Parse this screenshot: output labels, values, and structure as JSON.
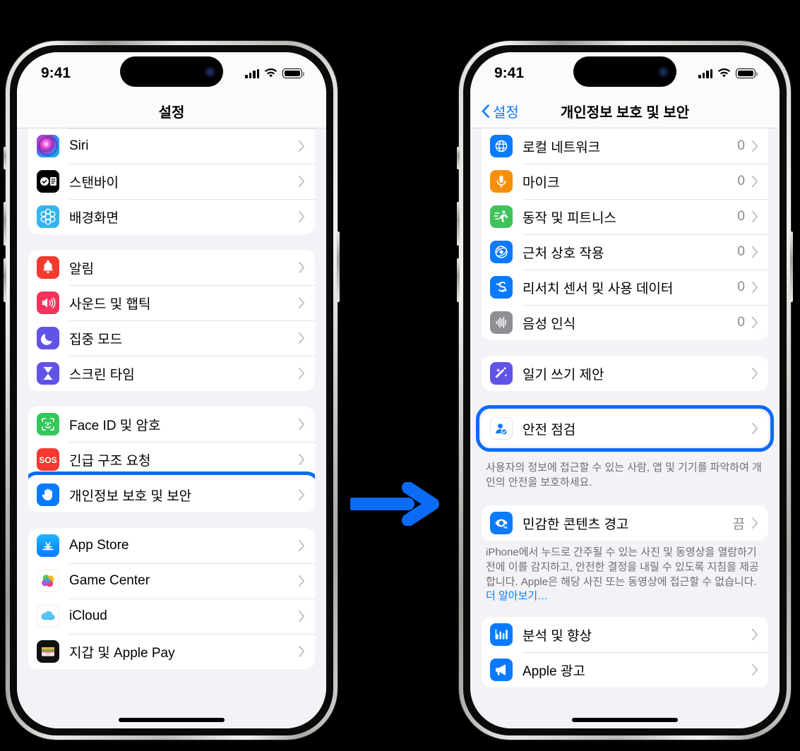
{
  "meta": {
    "background_color": "#000000",
    "accent_color": "#0a6cf5",
    "ios_blue": "#0a7aff"
  },
  "arrow": {
    "name": "right-arrow",
    "color": "#0a6cf5"
  },
  "phones": [
    {
      "id": "settings-phone",
      "status_bar": {
        "time": "9:41",
        "signal": "cellular-bars-icon",
        "wifi": "wifi-icon",
        "battery": "battery-full-icon"
      },
      "nav": {
        "title": "설정",
        "back_label": null
      },
      "groups": [
        {
          "flush_top": true,
          "rows": [
            {
              "label": "Siri",
              "icon": "siri-icon",
              "value": "",
              "highlighted": false
            },
            {
              "label": "스탠바이",
              "icon": "standby-icon",
              "value": "",
              "highlighted": false
            },
            {
              "label": "배경화면",
              "icon": "wallpaper-icon",
              "value": "",
              "highlighted": false
            }
          ]
        },
        {
          "rows": [
            {
              "label": "알림",
              "icon": "notifications-icon",
              "value": "",
              "highlighted": false
            },
            {
              "label": "사운드 및 햅틱",
              "icon": "sounds-haptics-icon",
              "value": "",
              "highlighted": false
            },
            {
              "label": "집중 모드",
              "icon": "focus-icon",
              "value": "",
              "highlighted": false
            },
            {
              "label": "스크린 타임",
              "icon": "screen-time-icon",
              "value": "",
              "highlighted": false
            }
          ]
        },
        {
          "rows": [
            {
              "label": "Face ID 및 암호",
              "icon": "face-id-icon",
              "value": "",
              "highlighted": false
            },
            {
              "label": "긴급 구조 요청",
              "icon": "emergency-sos-icon",
              "value": "",
              "highlighted": false
            },
            {
              "label": "개인정보 보호 및 보안",
              "icon": "privacy-hand-icon",
              "value": "",
              "highlighted": true
            }
          ]
        },
        {
          "rows": [
            {
              "label": "App Store",
              "icon": "app-store-icon",
              "value": "",
              "highlighted": false
            },
            {
              "label": "Game Center",
              "icon": "game-center-icon",
              "value": "",
              "highlighted": false
            },
            {
              "label": "iCloud",
              "icon": "icloud-icon",
              "value": "",
              "highlighted": false
            },
            {
              "label": "지갑 및 Apple Pay",
              "icon": "wallet-icon",
              "value": "",
              "highlighted": false
            }
          ]
        }
      ]
    },
    {
      "id": "privacy-phone",
      "status_bar": {
        "time": "9:41",
        "signal": "cellular-bars-icon",
        "wifi": "wifi-icon",
        "battery": "battery-full-icon"
      },
      "nav": {
        "title": "개인정보 보호 및 보안",
        "back_label": "설정"
      },
      "groups": [
        {
          "flush_top": true,
          "rows": [
            {
              "label": "로컬 네트워크",
              "icon": "local-network-icon",
              "value": "0",
              "highlighted": false
            },
            {
              "label": "마이크",
              "icon": "microphone-icon",
              "value": "0",
              "highlighted": false
            },
            {
              "label": "동작 및 피트니스",
              "icon": "motion-fitness-icon",
              "value": "0",
              "highlighted": false
            },
            {
              "label": "근처 상호 작용",
              "icon": "nearby-interactions-icon",
              "value": "0",
              "highlighted": false
            },
            {
              "label": "리서치 센서 및 사용 데이터",
              "icon": "research-sensor-icon",
              "value": "0",
              "highlighted": false
            },
            {
              "label": "음성 인식",
              "icon": "speech-recognition-icon",
              "value": "0",
              "highlighted": false
            }
          ]
        },
        {
          "rows": [
            {
              "label": "일기 쓰기 제안",
              "icon": "journaling-suggestions-icon",
              "value": "",
              "highlighted": false
            }
          ]
        },
        {
          "rows": [
            {
              "label": "안전 점검",
              "icon": "safety-check-icon",
              "value": "",
              "highlighted": true
            }
          ],
          "footnote": "사용자의 정보에 접근할 수 있는 사람, 앱 및 기기를 파악하여 개인의 안전을 보호하세요."
        },
        {
          "rows": [
            {
              "label": "민감한 콘텐츠 경고",
              "icon": "sensitive-content-icon",
              "value": "끔",
              "highlighted": false
            }
          ],
          "footnote_prefix": "iPhone에서 누드로 간주될 수 있는 사진 및 동영상을 열람하기 전에 이를 감지하고, 안전한 결정을 내릴 수 있도록 지침을 제공합니다. Apple은 해당 사진 또는 동영상에 접근할 수 없습니다. ",
          "footnote_link": "더 알아보기…"
        },
        {
          "rows": [
            {
              "label": "분석 및 향상",
              "icon": "analytics-icon",
              "value": "",
              "highlighted": false
            },
            {
              "label": "Apple 광고",
              "icon": "apple-advertising-icon",
              "value": "",
              "highlighted": false
            }
          ]
        }
      ]
    }
  ]
}
